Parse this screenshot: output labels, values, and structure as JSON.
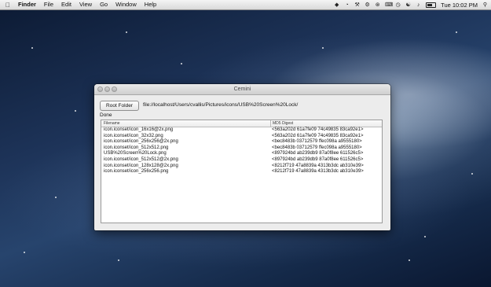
{
  "menubar": {
    "apple_icon": "apple-icon",
    "items": [
      {
        "label": "Finder",
        "bold": true
      },
      {
        "label": "File"
      },
      {
        "label": "Edit"
      },
      {
        "label": "View"
      },
      {
        "label": "Go"
      },
      {
        "label": "Window"
      },
      {
        "label": "Help"
      }
    ],
    "clock": "Tue 10:02 PM",
    "status_icons": [
      "dropbox-icon",
      "sync-icon",
      "wrench-icon",
      "gear-icon",
      "bluetooth-icon",
      "keyboard-icon",
      "time-machine-icon",
      "wifi-icon",
      "volume-icon",
      "battery-icon",
      "search-icon"
    ]
  },
  "window": {
    "title": "Cemini",
    "root_folder_label": "Root Folder",
    "path": "file://localhost/Users/cvallis/Pictures/icons/USB%20Screen%20Lock/",
    "status": "Done",
    "table": {
      "columns": [
        "Filename",
        "MD5 Digest"
      ],
      "rows": [
        [
          "icon.iconset/icon_16x16@2x.png",
          "<563a202d 61a7fe09 74c49835 83ca92e1>"
        ],
        [
          "icon.iconset/icon_32x32.png",
          "<563a202d 61a7fe09 74c49835 83ca92e1>"
        ],
        [
          "icon.iconset/icon_256x256@2x.png",
          "<bec8483b 03712579 ffec098a a9555180>"
        ],
        [
          "icon.iconset/icon_512x512.png",
          "<bec8483b 03712579 ffec098a a9555180>"
        ],
        [
          "USB%20Screen%20Lock.png",
          "<897924bd ab239db9 87a0f8ee 611526c5>"
        ],
        [
          "icon.iconset/icon_512x512@2x.png",
          "<897924bd ab239db9 87a0f8ee 611526c5>"
        ],
        [
          "icon.iconset/icon_128x128@2x.png",
          "<8212f719 47a8839a 4313b3dc ab310e39>"
        ],
        [
          "icon.iconset/icon_256x256.png",
          "<8212f719 47a8839a 4313b3dc ab310e39>"
        ]
      ]
    }
  }
}
